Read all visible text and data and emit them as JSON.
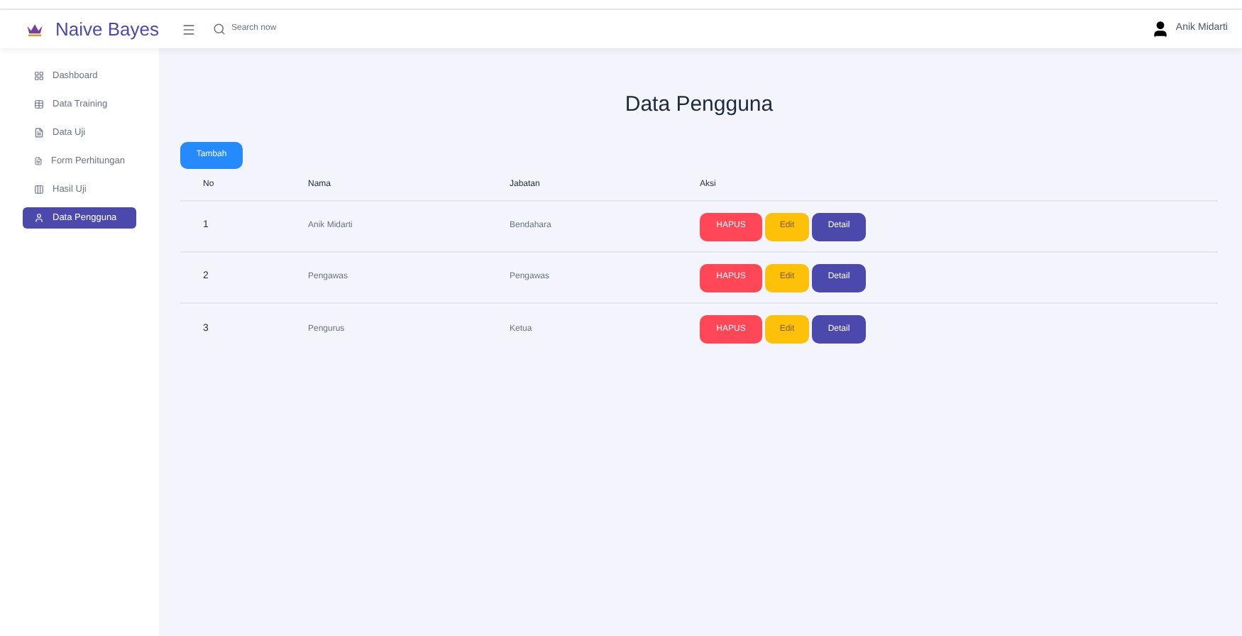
{
  "header": {
    "brand": "Naive Bayes",
    "search": {
      "placeholder": "Search now"
    },
    "user": "Anik Midarti"
  },
  "sidebar": {
    "items": [
      {
        "label": "Dashboard",
        "selected": false
      },
      {
        "label": "Data Training",
        "selected": false
      },
      {
        "label": "Data Uji",
        "selected": false
      },
      {
        "label": "Form Perhitungan",
        "selected": false
      },
      {
        "label": "Hasil Uji",
        "selected": false
      },
      {
        "label": "Data Pengguna",
        "selected": true
      }
    ]
  },
  "page": {
    "title": "Data Pengguna",
    "add_button": "Tambah"
  },
  "table": {
    "columns": [
      "No",
      "Nama",
      "Jabatan",
      "Aksi"
    ],
    "rows": [
      {
        "no": "1",
        "nama": "Anik Midarti",
        "jabatan": "Bendahara",
        "actions": [
          "HAPUS",
          "Edit",
          "Detail"
        ]
      },
      {
        "no": "2",
        "nama": "Pengawas",
        "jabatan": "Pengawas",
        "actions": [
          "HAPUS",
          "Edit",
          "Detail"
        ]
      },
      {
        "no": "3",
        "nama": "Pengurus",
        "jabatan": "Ketua",
        "actions": [
          "HAPUS",
          "Edit",
          "Detail"
        ]
      }
    ]
  }
}
